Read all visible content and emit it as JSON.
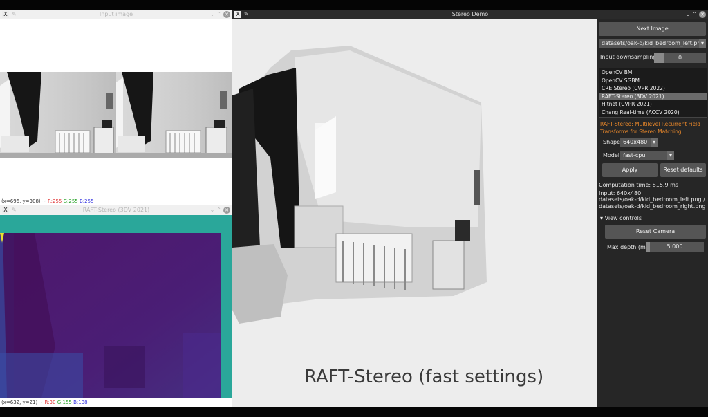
{
  "input_window": {
    "title": "Input image",
    "status_coords": "(x=696, y=308) ~",
    "status_r": "R:255",
    "status_g": "G:255",
    "status_b": "B:255"
  },
  "raft_window": {
    "title": "RAFT-Stereo (3DV 2021)",
    "status_coords": "(x=632, y=21) ~",
    "status_r": "R:30",
    "status_g": "G:155",
    "status_b": "B:138"
  },
  "stereo_window": {
    "title": "Stereo Demo",
    "caption": "RAFT-Stereo (fast settings)"
  },
  "panel": {
    "next_image": "Next Image",
    "dataset_selected": "datasets/oak-d/kid_bedroom_left.png",
    "input_downsampling_label": "Input downsampling",
    "input_downsampling_value": "0",
    "methods": [
      "OpenCV BM",
      "OpenCV SGBM",
      "CRE Stereo (CVPR 2022)",
      "RAFT-Stereo (3DV 2021)",
      "Hitnet (CVPR 2021)",
      "Chang Real-time (ACCV 2020)"
    ],
    "method_selected_index": 3,
    "description": "RAFT-Stereo: Multilevel Recurrent Field Transforms for Stereo Matching.",
    "shape_label": "Shape",
    "shape_value": "640x480",
    "model_label": "Model",
    "model_value": "fast-cpu",
    "apply": "Apply",
    "reset_defaults": "Reset defaults",
    "computation_time": "Computation time: 815.9 ms",
    "input_size": "Input: 640x480",
    "input_files": "datasets/oak-d/kid_bedroom_left.png / datasets/oak-d/kid_bedroom_right.png",
    "view_controls": "View controls",
    "reset_camera": "Reset Camera",
    "max_depth_label": "Max depth (m)",
    "max_depth_value": "5.000",
    "max_depth_fraction": 0.03
  },
  "icons": {
    "app_icon": "X",
    "pin_icon": "pin-icon",
    "minimize_icon": "chevron-down-icon",
    "maximize_icon": "chevron-up-icon",
    "close_icon": "close-icon"
  },
  "colors": {
    "accent_orange": "#e8872a",
    "panel_bg": "#262626",
    "disparity_purple": "#4a176a",
    "disparity_teal": "#2aa79a"
  }
}
